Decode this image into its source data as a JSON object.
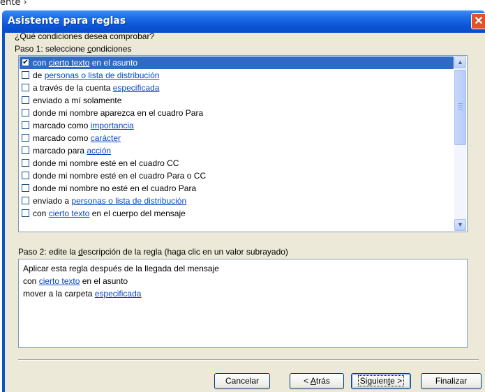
{
  "outer_fragment": "ente ›",
  "window": {
    "title": "Asistente para reglas",
    "close_glyph": "✕"
  },
  "question": "¿Qué condiciones desea comprobar?",
  "step1": {
    "prefix": "Paso 1: seleccione ",
    "underlined": "c",
    "suffix": "ondiciones"
  },
  "conditions": [
    {
      "checked": true,
      "parts": [
        [
          "con ",
          false
        ],
        [
          "cierto texto",
          true
        ],
        [
          " en el asunto",
          false
        ]
      ]
    },
    {
      "checked": false,
      "parts": [
        [
          "de ",
          false
        ],
        [
          "personas o lista de distribución",
          true
        ]
      ]
    },
    {
      "checked": false,
      "parts": [
        [
          "a través de la cuenta ",
          false
        ],
        [
          "especificada",
          true
        ]
      ]
    },
    {
      "checked": false,
      "parts": [
        [
          "enviado a mí solamente",
          false
        ]
      ]
    },
    {
      "checked": false,
      "parts": [
        [
          "donde mi nombre aparezca en el cuadro Para",
          false
        ]
      ]
    },
    {
      "checked": false,
      "parts": [
        [
          "marcado como ",
          false
        ],
        [
          "importancia",
          true
        ]
      ]
    },
    {
      "checked": false,
      "parts": [
        [
          "marcado como ",
          false
        ],
        [
          "carácter",
          true
        ]
      ]
    },
    {
      "checked": false,
      "parts": [
        [
          "marcado para ",
          false
        ],
        [
          "acción",
          true
        ]
      ]
    },
    {
      "checked": false,
      "parts": [
        [
          "donde mi nombre esté en el cuadro CC",
          false
        ]
      ]
    },
    {
      "checked": false,
      "parts": [
        [
          "donde mi nombre esté en el cuadro Para o CC",
          false
        ]
      ]
    },
    {
      "checked": false,
      "parts": [
        [
          "donde mi nombre no esté en el cuadro Para",
          false
        ]
      ]
    },
    {
      "checked": false,
      "parts": [
        [
          "enviado a ",
          false
        ],
        [
          "personas o lista de distribución",
          true
        ]
      ]
    },
    {
      "checked": false,
      "parts": [
        [
          "con ",
          false
        ],
        [
          "cierto texto",
          true
        ],
        [
          " en el cuerpo del mensaje",
          false
        ]
      ]
    }
  ],
  "step2": {
    "prefix": "Paso 2: edite la ",
    "underlined": "d",
    "suffix": "escripción de la regla (haga clic en un valor subrayado)"
  },
  "description": [
    [
      [
        "Aplicar esta regla después de la llegada del mensaje",
        false
      ]
    ],
    [
      [
        "con ",
        false
      ],
      [
        "cierto texto",
        true
      ],
      [
        " en el asunto",
        false
      ]
    ],
    [
      [
        "mover a la carpeta ",
        false
      ],
      [
        "especificada",
        true
      ]
    ]
  ],
  "buttons": {
    "cancel": "Cancelar",
    "back": {
      "prefix": "< ",
      "underlined": "A",
      "suffix": "trás"
    },
    "next": {
      "prefix": "Siguien",
      "underlined": "t",
      "suffix": "e >"
    },
    "finish": "Finalizar"
  },
  "scroll": {
    "up_glyph": "▲",
    "down_glyph": "▼"
  },
  "checkmark": "✔"
}
